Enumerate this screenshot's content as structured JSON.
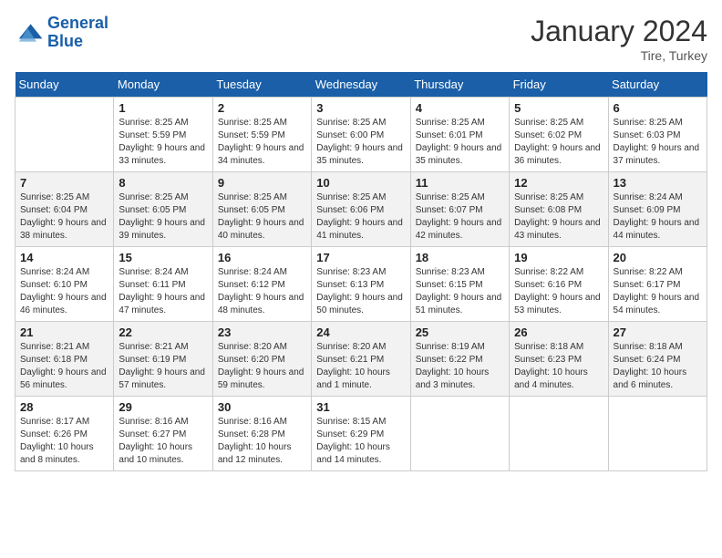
{
  "header": {
    "logo_line1": "General",
    "logo_line2": "Blue",
    "month": "January 2024",
    "location": "Tire, Turkey"
  },
  "weekdays": [
    "Sunday",
    "Monday",
    "Tuesday",
    "Wednesday",
    "Thursday",
    "Friday",
    "Saturday"
  ],
  "days": [
    {
      "num": "",
      "sunrise": "",
      "sunset": "",
      "daylight": ""
    },
    {
      "num": "1",
      "sunrise": "8:25 AM",
      "sunset": "5:59 PM",
      "daylight": "9 hours and 33 minutes."
    },
    {
      "num": "2",
      "sunrise": "8:25 AM",
      "sunset": "5:59 PM",
      "daylight": "9 hours and 34 minutes."
    },
    {
      "num": "3",
      "sunrise": "8:25 AM",
      "sunset": "6:00 PM",
      "daylight": "9 hours and 35 minutes."
    },
    {
      "num": "4",
      "sunrise": "8:25 AM",
      "sunset": "6:01 PM",
      "daylight": "9 hours and 35 minutes."
    },
    {
      "num": "5",
      "sunrise": "8:25 AM",
      "sunset": "6:02 PM",
      "daylight": "9 hours and 36 minutes."
    },
    {
      "num": "6",
      "sunrise": "8:25 AM",
      "sunset": "6:03 PM",
      "daylight": "9 hours and 37 minutes."
    },
    {
      "num": "7",
      "sunrise": "8:25 AM",
      "sunset": "6:04 PM",
      "daylight": "9 hours and 38 minutes."
    },
    {
      "num": "8",
      "sunrise": "8:25 AM",
      "sunset": "6:05 PM",
      "daylight": "9 hours and 39 minutes."
    },
    {
      "num": "9",
      "sunrise": "8:25 AM",
      "sunset": "6:05 PM",
      "daylight": "9 hours and 40 minutes."
    },
    {
      "num": "10",
      "sunrise": "8:25 AM",
      "sunset": "6:06 PM",
      "daylight": "9 hours and 41 minutes."
    },
    {
      "num": "11",
      "sunrise": "8:25 AM",
      "sunset": "6:07 PM",
      "daylight": "9 hours and 42 minutes."
    },
    {
      "num": "12",
      "sunrise": "8:25 AM",
      "sunset": "6:08 PM",
      "daylight": "9 hours and 43 minutes."
    },
    {
      "num": "13",
      "sunrise": "8:24 AM",
      "sunset": "6:09 PM",
      "daylight": "9 hours and 44 minutes."
    },
    {
      "num": "14",
      "sunrise": "8:24 AM",
      "sunset": "6:10 PM",
      "daylight": "9 hours and 46 minutes."
    },
    {
      "num": "15",
      "sunrise": "8:24 AM",
      "sunset": "6:11 PM",
      "daylight": "9 hours and 47 minutes."
    },
    {
      "num": "16",
      "sunrise": "8:24 AM",
      "sunset": "6:12 PM",
      "daylight": "9 hours and 48 minutes."
    },
    {
      "num": "17",
      "sunrise": "8:23 AM",
      "sunset": "6:13 PM",
      "daylight": "9 hours and 50 minutes."
    },
    {
      "num": "18",
      "sunrise": "8:23 AM",
      "sunset": "6:15 PM",
      "daylight": "9 hours and 51 minutes."
    },
    {
      "num": "19",
      "sunrise": "8:22 AM",
      "sunset": "6:16 PM",
      "daylight": "9 hours and 53 minutes."
    },
    {
      "num": "20",
      "sunrise": "8:22 AM",
      "sunset": "6:17 PM",
      "daylight": "9 hours and 54 minutes."
    },
    {
      "num": "21",
      "sunrise": "8:21 AM",
      "sunset": "6:18 PM",
      "daylight": "9 hours and 56 minutes."
    },
    {
      "num": "22",
      "sunrise": "8:21 AM",
      "sunset": "6:19 PM",
      "daylight": "9 hours and 57 minutes."
    },
    {
      "num": "23",
      "sunrise": "8:20 AM",
      "sunset": "6:20 PM",
      "daylight": "9 hours and 59 minutes."
    },
    {
      "num": "24",
      "sunrise": "8:20 AM",
      "sunset": "6:21 PM",
      "daylight": "10 hours and 1 minute."
    },
    {
      "num": "25",
      "sunrise": "8:19 AM",
      "sunset": "6:22 PM",
      "daylight": "10 hours and 3 minutes."
    },
    {
      "num": "26",
      "sunrise": "8:18 AM",
      "sunset": "6:23 PM",
      "daylight": "10 hours and 4 minutes."
    },
    {
      "num": "27",
      "sunrise": "8:18 AM",
      "sunset": "6:24 PM",
      "daylight": "10 hours and 6 minutes."
    },
    {
      "num": "28",
      "sunrise": "8:17 AM",
      "sunset": "6:26 PM",
      "daylight": "10 hours and 8 minutes."
    },
    {
      "num": "29",
      "sunrise": "8:16 AM",
      "sunset": "6:27 PM",
      "daylight": "10 hours and 10 minutes."
    },
    {
      "num": "30",
      "sunrise": "8:16 AM",
      "sunset": "6:28 PM",
      "daylight": "10 hours and 12 minutes."
    },
    {
      "num": "31",
      "sunrise": "8:15 AM",
      "sunset": "6:29 PM",
      "daylight": "10 hours and 14 minutes."
    }
  ]
}
